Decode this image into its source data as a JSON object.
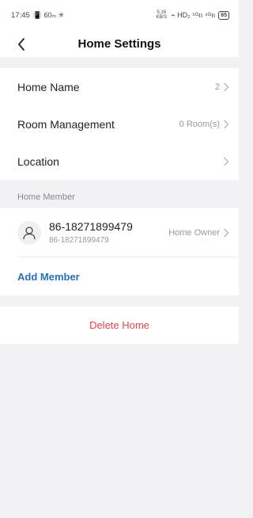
{
  "status_bar": {
    "time": "17:45",
    "left_icons": "📳 60ₘ ✳",
    "net_speed": "5.16 KB/S",
    "right_icons": "⌁ HD₂ ⁵ᴳıı ⁴ᴳıı",
    "battery": "65"
  },
  "nav": {
    "title": "Home Settings",
    "back_icon": "chevron-left-icon"
  },
  "settings": {
    "home_name": {
      "label": "Home Name",
      "value": "2"
    },
    "room_management": {
      "label": "Room Management",
      "value": "0 Room(s)"
    },
    "location": {
      "label": "Location",
      "value": ""
    }
  },
  "members": {
    "header": "Home Member",
    "items": [
      {
        "name": "86-18271899479",
        "phone": "86-18271899479",
        "role": "Home Owner",
        "avatar_icon": "user-icon"
      }
    ],
    "add_label": "Add Member"
  },
  "actions": {
    "delete_label": "Delete Home"
  },
  "colors": {
    "background": "#f2f2f4",
    "link_blue": "#2a6fb8",
    "danger_red": "#e0474c",
    "secondary_text": "#999999"
  }
}
